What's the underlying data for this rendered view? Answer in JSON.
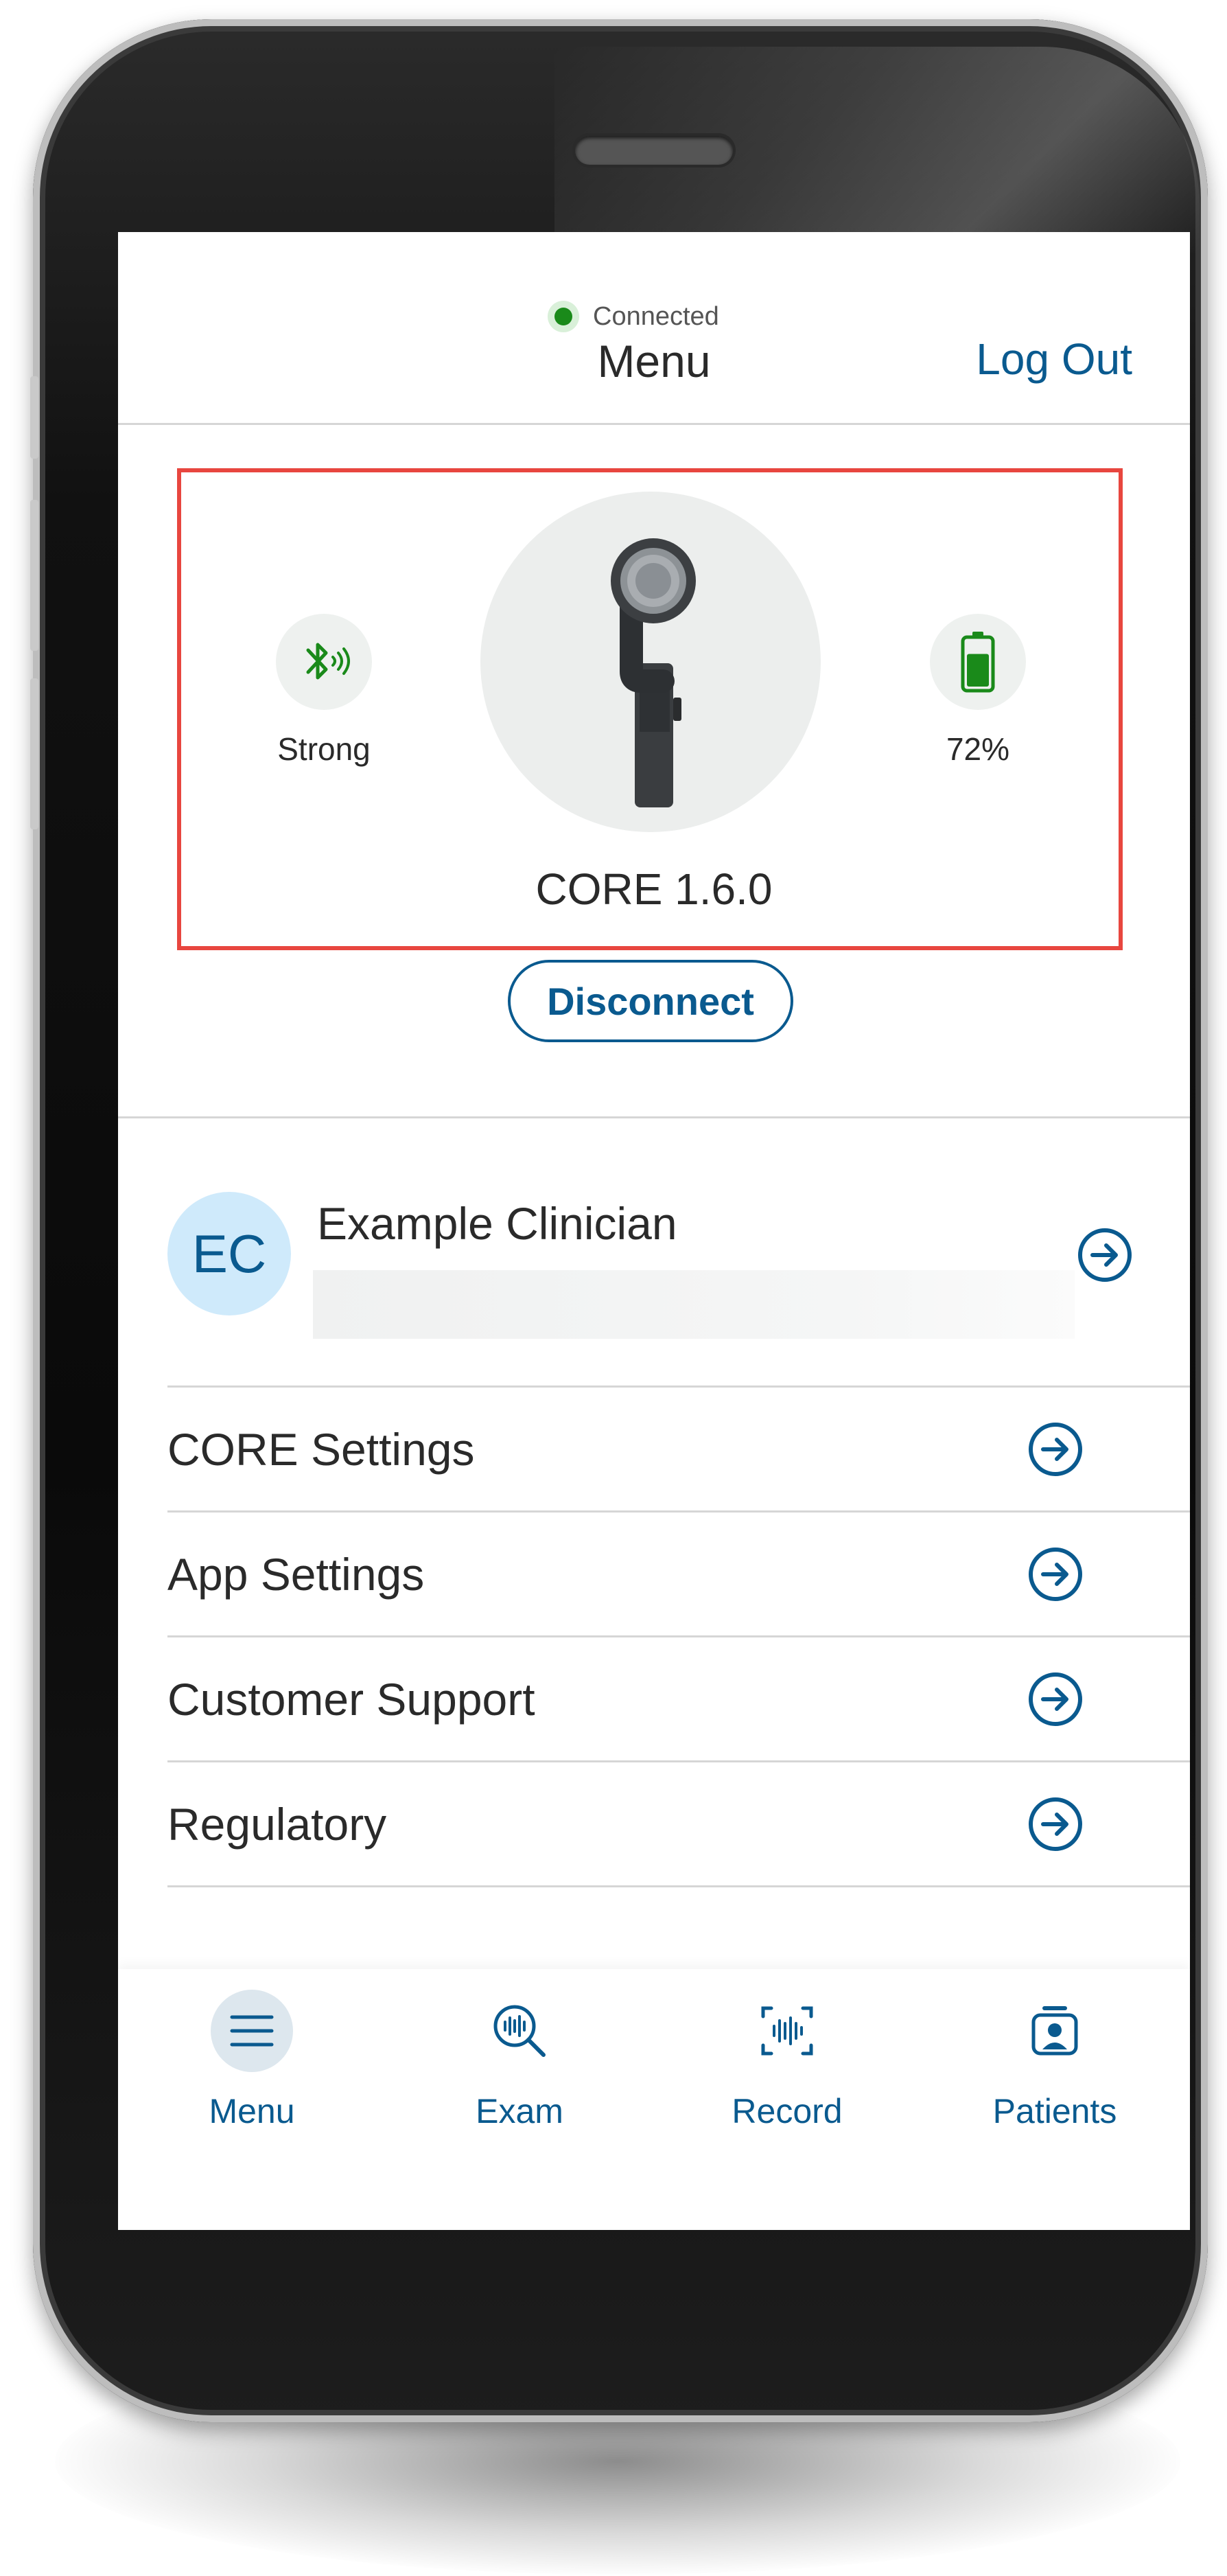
{
  "status": {
    "text": "Connected",
    "color": "#1a8a1a"
  },
  "header": {
    "title": "Menu",
    "logout_label": "Log Out"
  },
  "device": {
    "signal_label": "Strong",
    "battery_label": "72%",
    "battery_level": 0.72,
    "name": "CORE 1.6.0",
    "disconnect_label": "Disconnect"
  },
  "profile": {
    "initials": "EC",
    "name": "Example Clinician"
  },
  "menu": {
    "items": [
      {
        "label": "CORE Settings"
      },
      {
        "label": "App Settings"
      },
      {
        "label": "Customer Support"
      },
      {
        "label": "Regulatory"
      }
    ]
  },
  "nav": {
    "items": [
      {
        "label": "Menu",
        "icon": "menu-icon",
        "active": true
      },
      {
        "label": "Exam",
        "icon": "exam-icon",
        "active": false
      },
      {
        "label": "Record",
        "icon": "record-icon",
        "active": false
      },
      {
        "label": "Patients",
        "icon": "patients-icon",
        "active": false
      }
    ]
  },
  "colors": {
    "accent": "#0a5a8f",
    "highlight_box": "#e8463f",
    "avatar_bg": "#cfeafb"
  }
}
